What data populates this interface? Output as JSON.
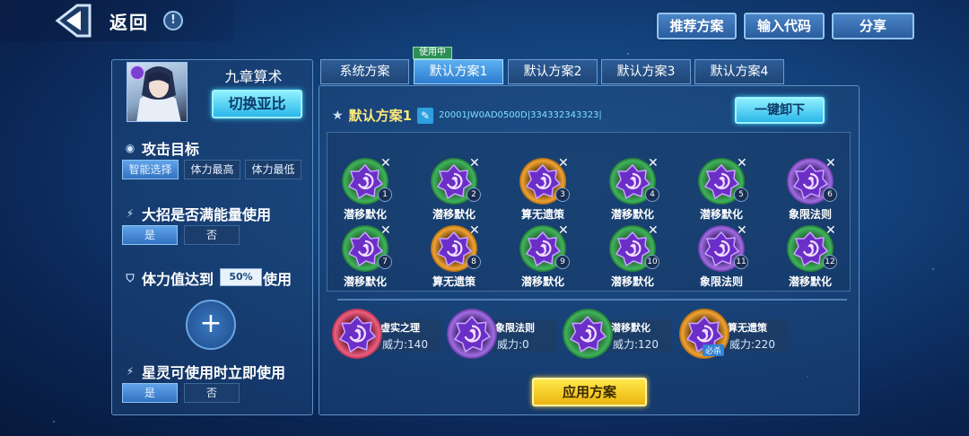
{
  "header": {
    "back_label": "返回",
    "info_icon": "!",
    "buttons": [
      "推荐方案",
      "输入代码",
      "分享"
    ]
  },
  "character": {
    "name": "九章算术",
    "switch_label": "切换亚比"
  },
  "attack_target": {
    "title": "攻击目标",
    "options": [
      "智能选择",
      "体力最高",
      "体力最低"
    ],
    "selected": 0
  },
  "ultimate": {
    "title": "大招是否满能量使用",
    "options": [
      "是",
      "否"
    ],
    "selected": 0
  },
  "hp": {
    "prefix": "体力值达到",
    "value": "50%",
    "suffix": "使用"
  },
  "star_spirit": {
    "title": "星灵可使用时立即使用",
    "options": [
      "是",
      "否"
    ],
    "selected": 0
  },
  "tabs": {
    "items": [
      "系统方案",
      "默认方案1",
      "默认方案2",
      "默认方案3",
      "默认方案4"
    ],
    "selected": 1,
    "in_use_badge": "使用中"
  },
  "plan": {
    "title": "默认方案1",
    "code": "20001JW0AD0500D|334332343323|",
    "unload_label": "一键卸下"
  },
  "runes": [
    {
      "name": "潜移默化",
      "num": "1",
      "color": "green"
    },
    {
      "name": "潜移默化",
      "num": "2",
      "color": "green"
    },
    {
      "name": "算无遗策",
      "num": "3",
      "color": "orange"
    },
    {
      "name": "潜移默化",
      "num": "4",
      "color": "green"
    },
    {
      "name": "潜移默化",
      "num": "5",
      "color": "green"
    },
    {
      "name": "象限法则",
      "num": "6",
      "color": "purple"
    },
    {
      "name": "潜移默化",
      "num": "7",
      "color": "green"
    },
    {
      "name": "算无遗策",
      "num": "8",
      "color": "orange"
    },
    {
      "name": "潜移默化",
      "num": "9",
      "color": "green"
    },
    {
      "name": "潜移默化",
      "num": "10",
      "color": "green"
    },
    {
      "name": "象限法则",
      "num": "11",
      "color": "purple"
    },
    {
      "name": "潜移默化",
      "num": "12",
      "color": "green"
    }
  ],
  "equipped": [
    {
      "name": "虚实之理",
      "power": "威力:140",
      "color": "red"
    },
    {
      "name": "象限法则",
      "power": "威力:0",
      "color": "purple"
    },
    {
      "name": "潜移默化",
      "power": "威力:120",
      "color": "green"
    },
    {
      "name": "算无遗策",
      "power": "威力:220",
      "color": "orange",
      "tag": "必杀"
    }
  ],
  "apply_label": "应用方案",
  "colors": {
    "accent": "#2bb6ea",
    "apply": "#ffe94a",
    "plan_title": "#ffe978"
  }
}
